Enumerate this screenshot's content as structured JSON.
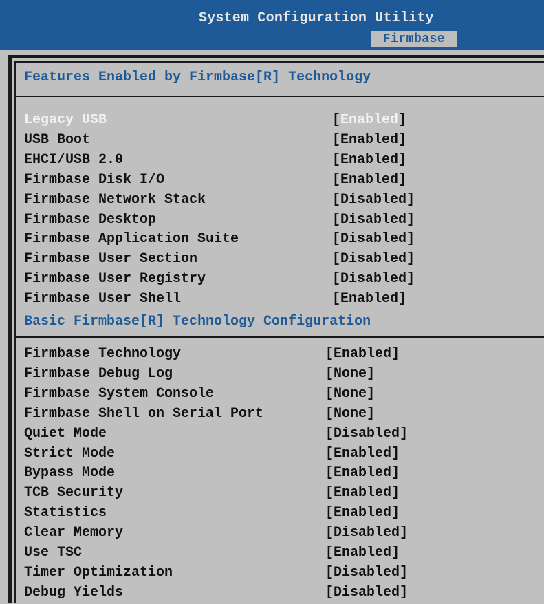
{
  "header": {
    "title": "System Configuration Utility",
    "active_tab": "Firmbase"
  },
  "sections": [
    {
      "title": "Features Enabled by Firmbase[R] Technology",
      "items": [
        {
          "label": "Legacy USB",
          "value": "Enabled",
          "selected": true
        },
        {
          "label": "USB Boot",
          "value": "Enabled"
        },
        {
          "label": "EHCI/USB 2.0",
          "value": "Enabled"
        },
        {
          "label": "Firmbase Disk I/O",
          "value": "Enabled"
        },
        {
          "label": "Firmbase Network Stack",
          "value": "Disabled"
        },
        {
          "label": "Firmbase Desktop",
          "value": "Disabled"
        },
        {
          "label": "Firmbase Application Suite",
          "value": "Disabled"
        },
        {
          "label": "Firmbase User Section",
          "value": "Disabled"
        },
        {
          "label": "Firmbase User Registry",
          "value": "Disabled"
        },
        {
          "label": "Firmbase User Shell",
          "value": "Enabled"
        }
      ]
    },
    {
      "title": "Basic Firmbase[R] Technology Configuration",
      "items": [
        {
          "label": "Firmbase Technology",
          "value": "Enabled"
        },
        {
          "label": "Firmbase Debug Log",
          "value": "None"
        },
        {
          "label": "Firmbase System Console",
          "value": "None"
        },
        {
          "label": "Firmbase Shell on Serial Port",
          "value": "None"
        },
        {
          "label": "Quiet Mode",
          "value": "Disabled"
        },
        {
          "label": "Strict Mode",
          "value": "Enabled"
        },
        {
          "label": "Bypass Mode",
          "value": "Enabled"
        },
        {
          "label": "TCB Security",
          "value": "Enabled"
        },
        {
          "label": "Statistics",
          "value": "Enabled"
        },
        {
          "label": "Clear Memory",
          "value": "Disabled"
        },
        {
          "label": "Use TSC",
          "value": "Enabled"
        },
        {
          "label": "Timer Optimization",
          "value": "Disabled"
        },
        {
          "label": "Debug Yields",
          "value": "Disabled"
        }
      ]
    }
  ],
  "colors": {
    "header_bg": "#1f5a98",
    "body_bg": "#c0c0c0",
    "section_title": "#1f5a98",
    "selected_text": "#f2f2f2"
  }
}
